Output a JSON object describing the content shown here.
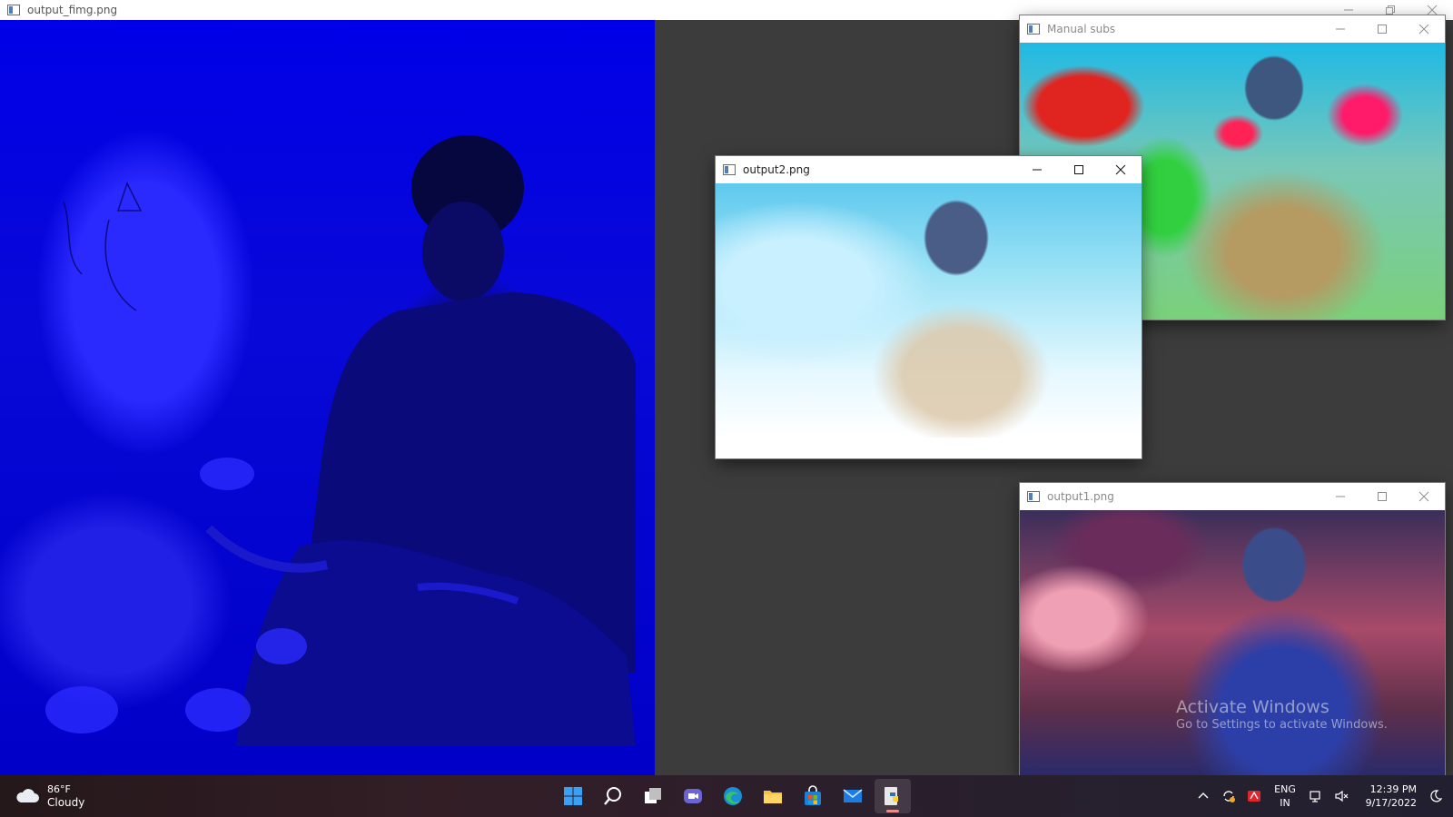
{
  "main_window": {
    "title": "output_fimg.png"
  },
  "windows": {
    "manual_subs": {
      "title": "Manual subs"
    },
    "output2": {
      "title": "output2.png"
    },
    "output1": {
      "title": "output1.png"
    }
  },
  "watermark": {
    "title": "Activate Windows",
    "subtitle": "Go to Settings to activate Windows."
  },
  "taskbar": {
    "weather": {
      "temperature": "86°F",
      "condition": "Cloudy",
      "icon": "cloud-icon"
    },
    "pinned_apps": [
      {
        "name": "start-icon"
      },
      {
        "name": "search-icon"
      },
      {
        "name": "task-view-icon"
      },
      {
        "name": "teams-chat-icon"
      },
      {
        "name": "edge-icon"
      },
      {
        "name": "file-explorer-icon"
      },
      {
        "name": "microsoft-store-icon"
      },
      {
        "name": "mail-icon"
      },
      {
        "name": "python-icon",
        "active": true
      }
    ],
    "tray": {
      "language_line1": "ENG",
      "language_line2": "IN",
      "time": "12:39 PM",
      "date": "9/17/2022"
    }
  },
  "colors": {
    "main_image_tint": "#0000e8",
    "desktop_background": "#3c3c3c",
    "taskbar_accent": "#f08a8a"
  }
}
